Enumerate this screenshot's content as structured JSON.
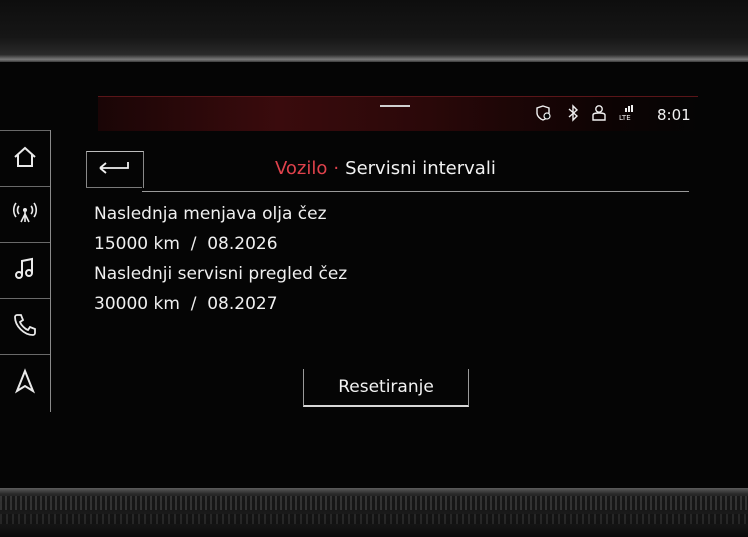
{
  "status": {
    "time": "8:01",
    "icons": [
      "location-shield-icon",
      "bluetooth-icon",
      "user-profile-icon",
      "lte-signal-icon"
    ]
  },
  "nav": {
    "items": [
      "home-icon",
      "radio-antenna-icon",
      "music-note-icon",
      "phone-icon",
      "navigation-arrow-icon"
    ]
  },
  "header": {
    "breadcrumb": "Vozilo",
    "separator": "·",
    "title": "Servisni intervali"
  },
  "content": {
    "oil_label": "Naslednja menjava olja čez",
    "oil_value": "15000 km  /  08.2026",
    "service_label": "Naslednji servisni pregled čez",
    "service_value": "30000 km  /  08.2027"
  },
  "actions": {
    "reset_label": "Resetiranje"
  },
  "colors": {
    "accent": "#e0424c",
    "background": "#050505",
    "text": "#f0f0f0"
  }
}
